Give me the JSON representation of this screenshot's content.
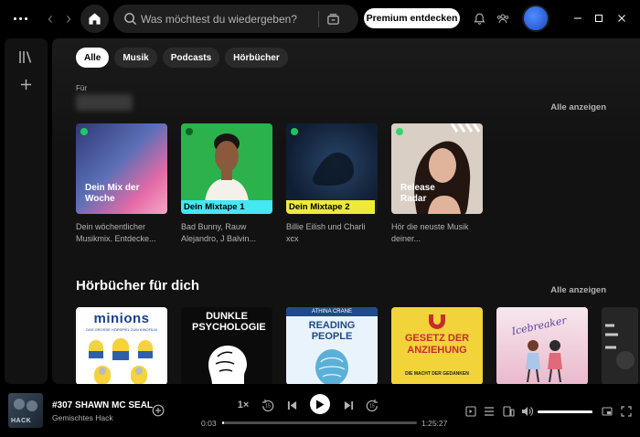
{
  "topbar": {
    "search_placeholder": "Was möchtest du wiedergeben?",
    "premium_label": "Premium entdecken",
    "window_controls": [
      "minimize",
      "maximize",
      "close"
    ]
  },
  "filters": [
    {
      "label": "Alle",
      "active": true
    },
    {
      "label": "Musik",
      "active": false
    },
    {
      "label": "Podcasts",
      "active": false
    },
    {
      "label": "Hörbücher",
      "active": false
    }
  ],
  "made_for": {
    "for_label": "Für",
    "see_all": "Alle anzeigen",
    "cards": [
      {
        "cover_title": "Dein Mix der Woche",
        "description": "Dein wöchentlicher Musikmix. Entdecke..."
      },
      {
        "cover_title": "Dein Mixtape 1",
        "description": "Bad Bunny, Rauw Alejandro, J Balvin..."
      },
      {
        "cover_title": "Dein Mixtape 2",
        "description": "Billie Eilish und Charli xcx"
      },
      {
        "cover_title": "Release Radar",
        "description": "Hör die neuste Musik deiner..."
      }
    ]
  },
  "audiobooks": {
    "title": "Hörbücher für dich",
    "see_all": "Alle anzeigen",
    "books": [
      {
        "title": "minions",
        "subtitle": "DAS GROSSE HÖRSPIEL ZUM KINOFILM"
      },
      {
        "title": "DUNKLE PSYCHOLOGIE",
        "subtitle": ""
      },
      {
        "author": "ATHINA CRANE",
        "title": "READING PEOPLE"
      },
      {
        "title": "GESETZ DER ANZIEHUNG",
        "subtitle": "DIE MACHT DER GEDANKEN"
      },
      {
        "title": "Icebreaker",
        "subtitle": ""
      },
      {
        "title": "",
        "subtitle": ""
      }
    ]
  },
  "now_playing": {
    "title": "#307 SHAWN MC SEAL",
    "subtitle": "Gemischtes Hack",
    "art_text": "HACK",
    "speed": "1×",
    "skip_back": "15",
    "skip_forward": "15",
    "elapsed": "0:03",
    "duration": "1:25:27",
    "progress": 0.002,
    "volume": 1.0
  }
}
